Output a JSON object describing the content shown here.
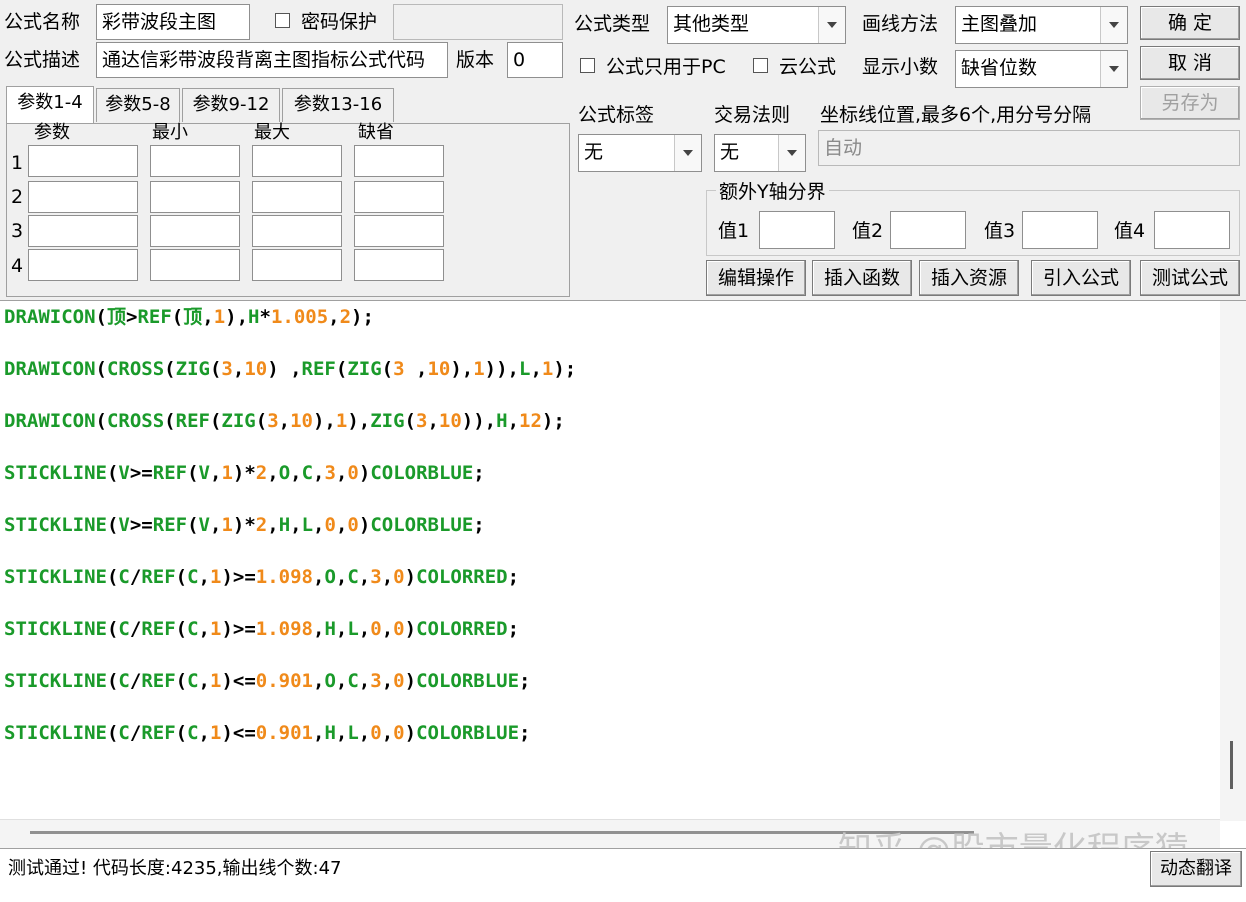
{
  "header": {
    "formula_name_label": "公式名称",
    "formula_name_value": "彩带波段主图",
    "password_label": "密码保护",
    "formula_desc_label": "公式描述",
    "formula_desc_value": "通达信彩带波段背离主图指标公式代码",
    "version_label": "版本",
    "version_value": "0",
    "formula_type_label": "公式类型",
    "formula_type_value": "其他类型",
    "draw_method_label": "画线方法",
    "draw_method_value": "主图叠加",
    "pc_only_label": "公式只用于PC",
    "cloud_label": "云公式",
    "decimal_label": "显示小数",
    "decimal_value": "缺省位数"
  },
  "buttons": {
    "ok": "确  定",
    "cancel": "取  消",
    "save_as": "另存为",
    "edit_ops": "编辑操作",
    "insert_func": "插入函数",
    "insert_res": "插入资源",
    "import_formula": "引入公式",
    "test_formula": "测试公式",
    "dynamic_translate": "动态翻译"
  },
  "tabs": [
    "参数1-4",
    "参数5-8",
    "参数9-12",
    "参数13-16"
  ],
  "params": {
    "col_param": "参数",
    "col_min": "最小",
    "col_max": "最大",
    "col_default": "缺省",
    "rows": [
      "1",
      "2",
      "3",
      "4"
    ]
  },
  "tag": {
    "label": "公式标签",
    "value": "无"
  },
  "trade_rule": {
    "label": "交易法则",
    "value": "无"
  },
  "axis": {
    "label": "坐标线位置,最多6个,用分号分隔",
    "value": "自动"
  },
  "extra_y": {
    "title": "额外Y轴分界",
    "v1": "值1",
    "v2": "值2",
    "v3": "值3",
    "v4": "值4"
  },
  "code_lines": [
    "DRAWICON(顶>REF(顶,1),H*1.005,2);",
    "DRAWICON(CROSS(ZIG(3,10) ,REF(ZIG(3 ,10),1)),L,1);",
    "DRAWICON(CROSS(REF(ZIG(3,10),1),ZIG(3,10)),H,12);",
    "STICKLINE(V>=REF(V,1)*2,O,C,3,0)COLORBLUE;",
    "STICKLINE(V>=REF(V,1)*2,H,L,0,0)COLORBLUE;",
    "STICKLINE(C/REF(C,1)>=1.098,O,C,3,0)COLORRED;",
    "STICKLINE(C/REF(C,1)>=1.098,H,L,0,0)COLORRED;",
    "STICKLINE(C/REF(C,1)<=0.901,O,C,3,0)COLORBLUE;",
    "STICKLINE(C/REF(C,1)<=0.901,H,L,0,0)COLORBLUE;"
  ],
  "status": {
    "message": "测试通过! 代码长度:4235,输出线个数:47"
  },
  "watermark": "知乎 @股市量化程序猿",
  "colors": {
    "function": "#1a9a2a",
    "number": "#f08a1a",
    "symbol": "#000000"
  }
}
